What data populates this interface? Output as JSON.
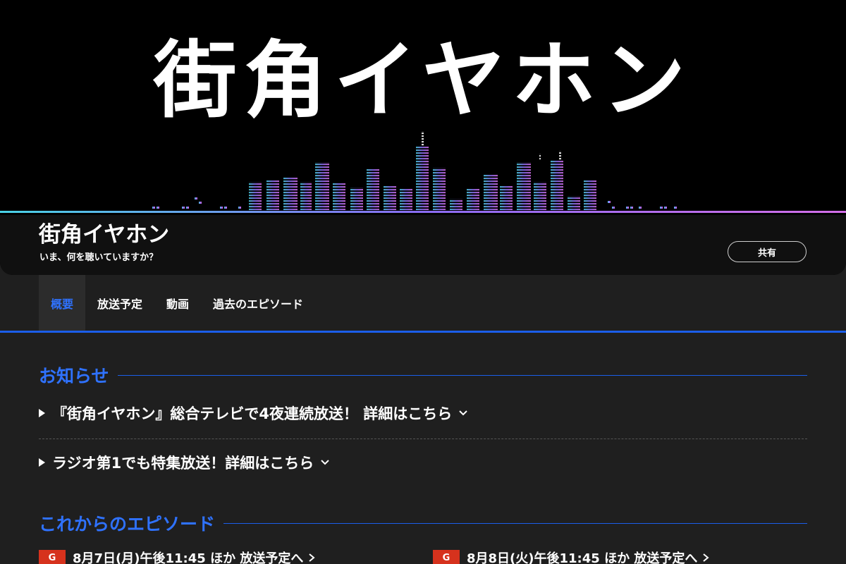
{
  "hero": {
    "logo_text": "街角イヤホン",
    "title": "街角イヤホン",
    "subtitle": "いま、何を聴いていますか？",
    "share_label": "共有",
    "accent_colors": [
      "#49d2e6",
      "#8a6cf2",
      "#d36ee8"
    ]
  },
  "tabs": [
    {
      "label": "概要",
      "active": true
    },
    {
      "label": "放送予定",
      "active": false
    },
    {
      "label": "動画",
      "active": false
    },
    {
      "label": "過去のエピソード",
      "active": false
    }
  ],
  "notices": {
    "heading": "お知らせ",
    "items": [
      {
        "text": "『街角イヤホン』総合テレビで4夜連続放送！ 詳細はこちら",
        "icon": "chevron-down-icon"
      },
      {
        "text": "ラジオ第1でも特集放送！詳細はこちら",
        "icon": "chevron-down-icon"
      }
    ]
  },
  "episodes": {
    "heading": "これからのエピソード",
    "items": [
      {
        "badge": "G",
        "text": "8月7日(月)午後11:45 ほか 放送予定へ",
        "icon": "chevron-right-icon"
      },
      {
        "badge": "G",
        "text": "8月8日(火)午後11:45 ほか 放送予定へ",
        "icon": "chevron-right-icon"
      }
    ]
  },
  "colors": {
    "accent_blue": "#2f72ff",
    "rule_blue": "#1b5eea",
    "badge_red": "#d6321d",
    "background": "#1f1f1f"
  }
}
